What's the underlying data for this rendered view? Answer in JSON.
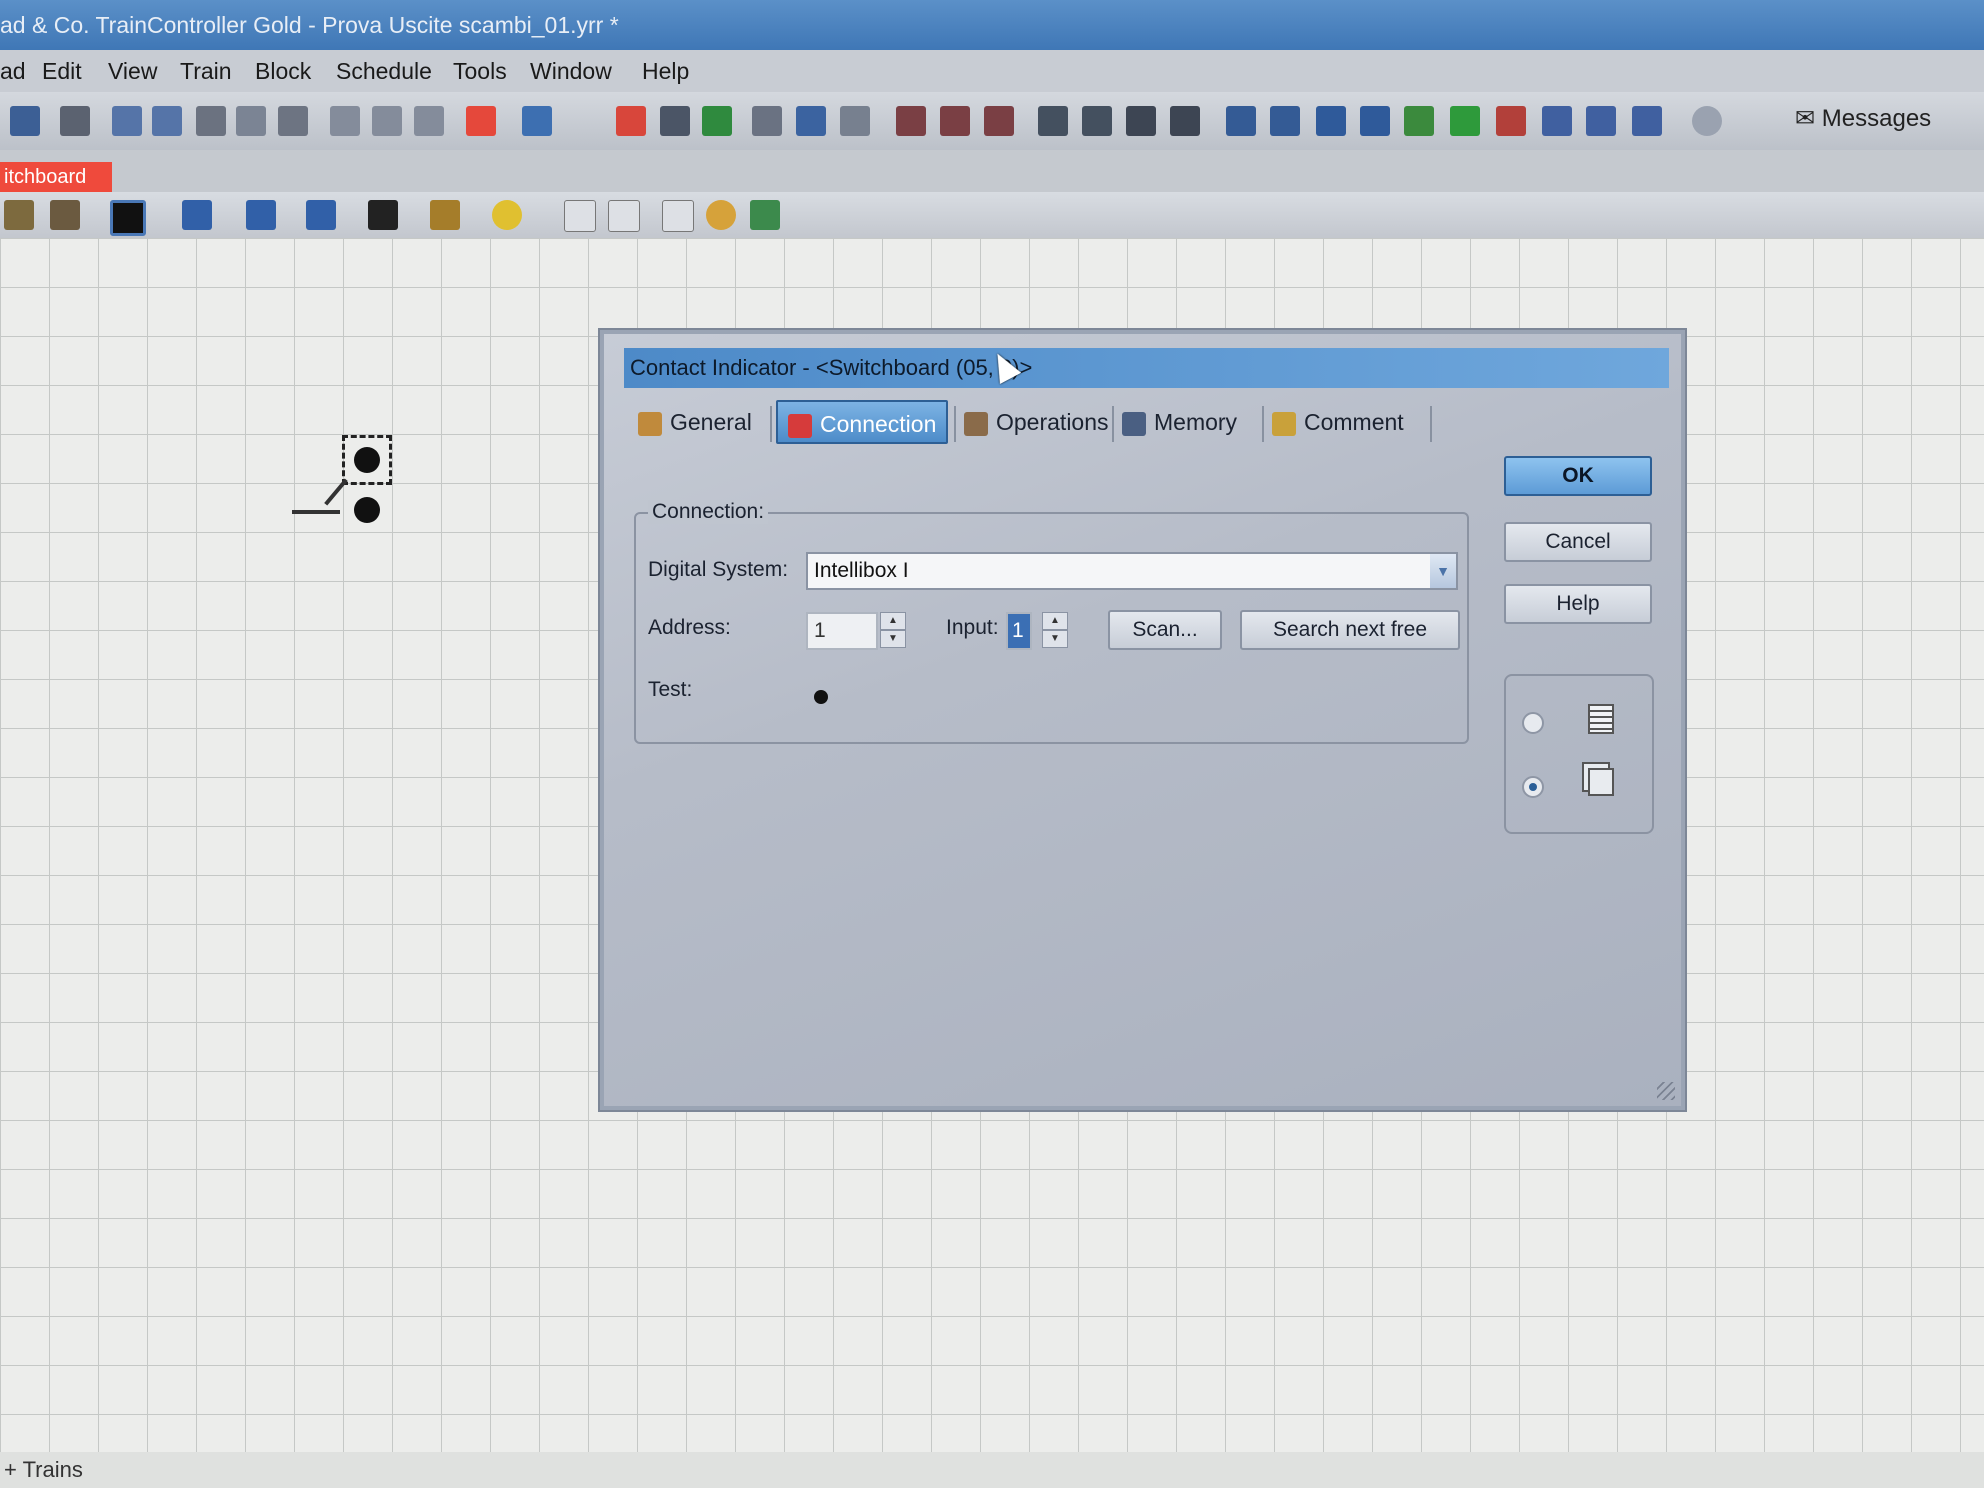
{
  "app": {
    "title": "ad & Co. TrainController Gold - Prova Uscite scambi_01.yrr *"
  },
  "menu": {
    "items": [
      "ad",
      "Edit",
      "View",
      "Train",
      "Block",
      "Schedule",
      "Tools",
      "Window",
      "Help"
    ]
  },
  "toolbar": {
    "messages_label": "Messages"
  },
  "workspace": {
    "tab_label": "itchboard",
    "status_label": "+ Trains"
  },
  "dialog": {
    "title": "Contact Indicator - <Switchboard (05, 0)>",
    "tabs": [
      {
        "label": "General",
        "icon": "general-icon"
      },
      {
        "label": "Connection",
        "icon": "plug-icon"
      },
      {
        "label": "Operations",
        "icon": "operations-icon"
      },
      {
        "label": "Memory",
        "icon": "memory-icon"
      },
      {
        "label": "Comment",
        "icon": "comment-icon"
      }
    ],
    "active_tab": "Connection",
    "connection": {
      "group_label": "Connection:",
      "digital_system_label": "Digital System:",
      "digital_system_value": "Intellibox I",
      "address_label": "Address:",
      "address_value": "1",
      "input_label": "Input:",
      "input_value": "1",
      "scan_label": "Scan...",
      "search_next_free_label": "Search next free",
      "test_label": "Test:"
    },
    "buttons": {
      "ok": "OK",
      "cancel": "Cancel",
      "help": "Help"
    },
    "view_mode": {
      "options": [
        "list-view-icon",
        "multi-window-icon"
      ],
      "selected": 1
    }
  },
  "colors": {
    "accent": "#4d8cc9",
    "switchboard_tab": "#ef4a3c"
  }
}
